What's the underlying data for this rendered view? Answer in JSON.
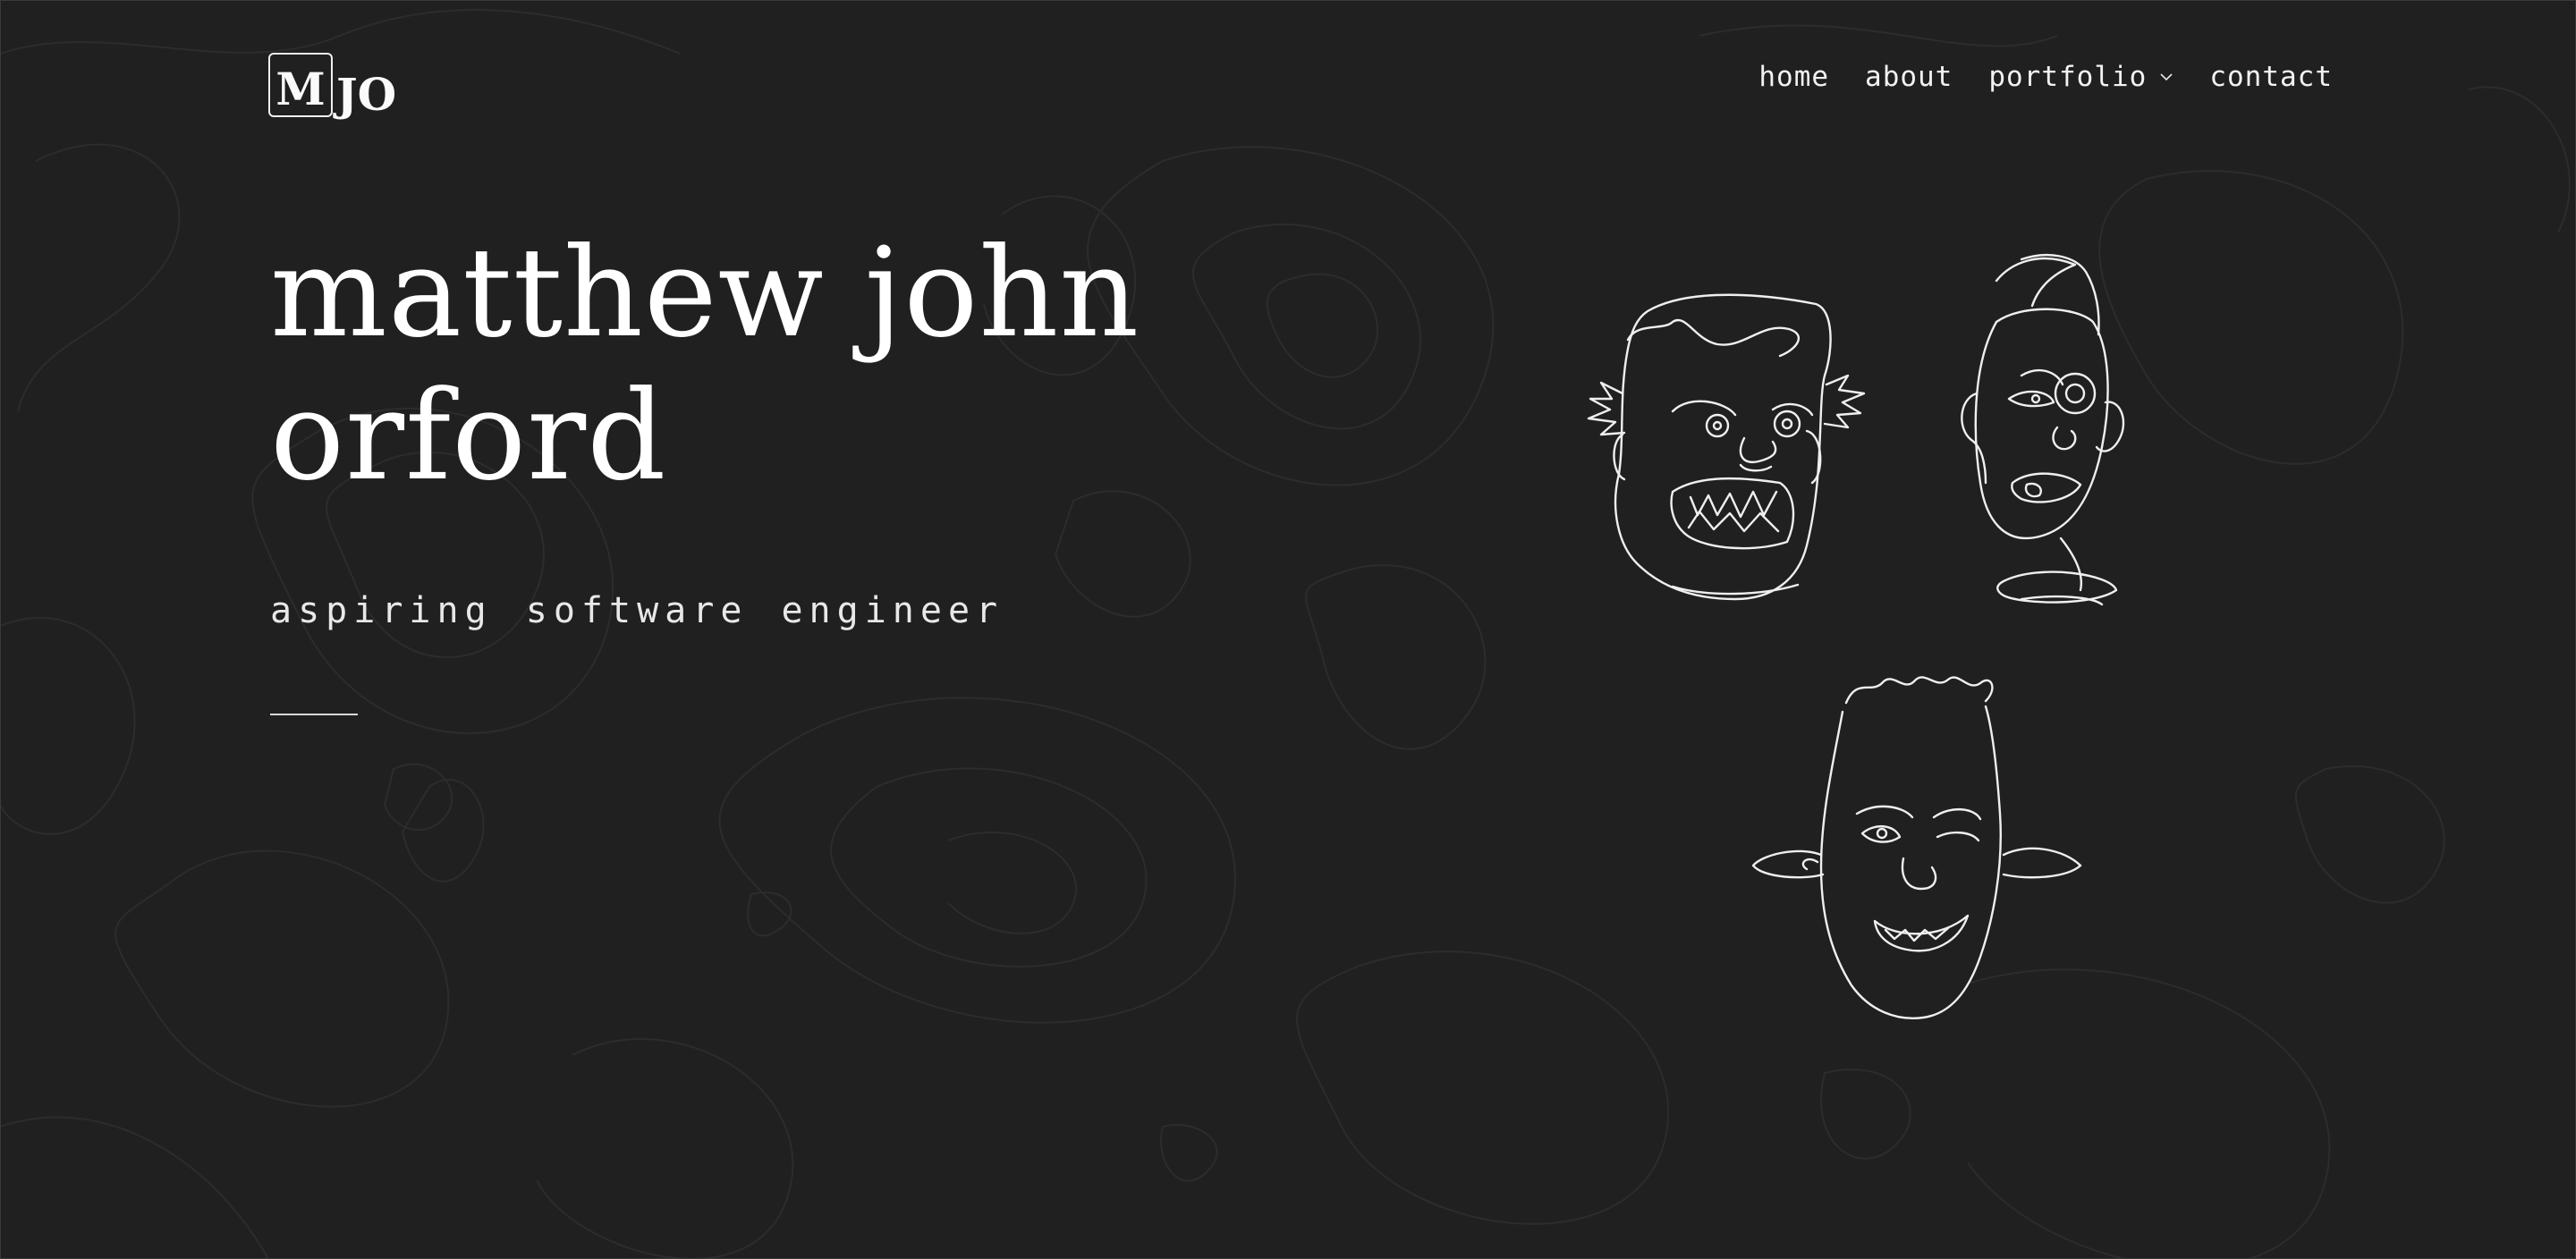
{
  "brand": {
    "logo_boxed": "M",
    "logo_rest": "JO"
  },
  "nav": {
    "items": [
      {
        "label": "home"
      },
      {
        "label": "about"
      },
      {
        "label": "portfolio"
      },
      {
        "label": "contact"
      }
    ],
    "portfolio_icon": "chevron-down-icon"
  },
  "hero": {
    "title_line1": "matthew john",
    "title_line2": "orford",
    "subtitle": "aspiring software engineer"
  },
  "illustrations": [
    "face-drawing-grimace",
    "face-drawing-squint",
    "face-drawing-grin"
  ],
  "colors": {
    "background": "#202020",
    "text": "#ffffff",
    "contour": "#2b2b2b"
  }
}
